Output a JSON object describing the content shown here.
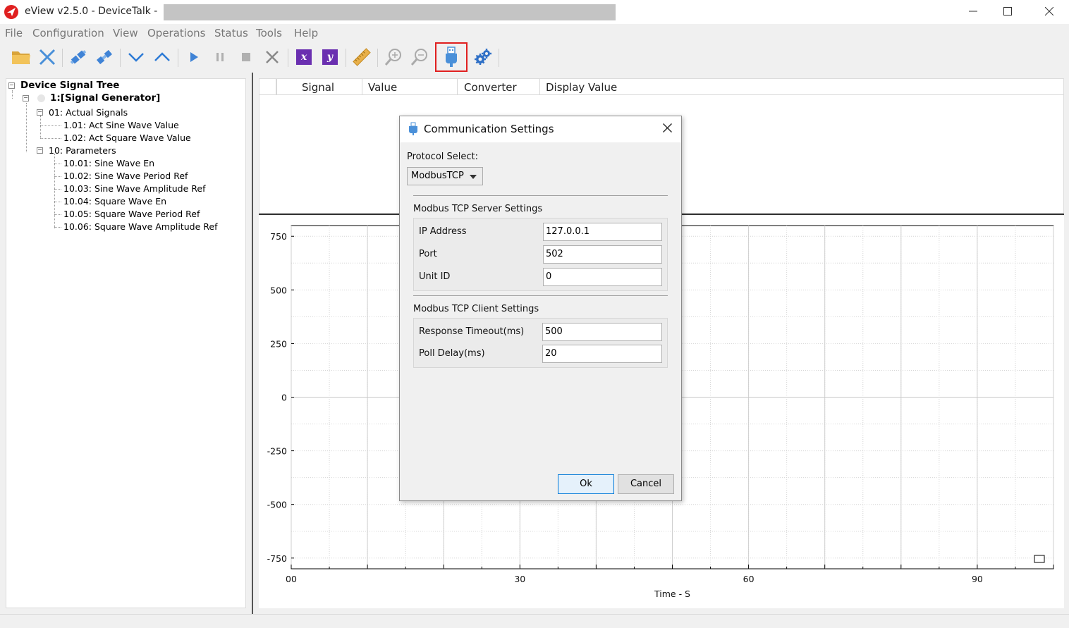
{
  "window": {
    "title": "eView v2.5.0 - DeviceTalk  -"
  },
  "menu": [
    "File",
    "Configuration",
    "View",
    "Operations",
    "Status",
    "Tools",
    "Help"
  ],
  "toolbar": {
    "icons": [
      "open-folder-icon",
      "close-x-icon",
      "connect-icon",
      "disconnect-icon",
      "chevron-down-icon",
      "chevron-up-icon",
      "play-icon",
      "pause-icon",
      "stop-icon",
      "cancel-icon",
      "x-axis-icon",
      "y-axis-icon",
      "ruler-icon",
      "zoom-in-icon",
      "zoom-out-icon",
      "usb-plug-icon",
      "gears-icon"
    ],
    "x_label": "x",
    "y_label": "y"
  },
  "tree": {
    "root": "Device Signal Tree",
    "device": "1:[Signal Generator]",
    "group1": "01: Actual Signals",
    "group1_items": [
      "1.01: Act Sine Wave Value",
      "1.02: Act Square Wave Value"
    ],
    "group2": "10: Parameters",
    "group2_items": [
      "10.01: Sine Wave En",
      "10.02: Sine Wave Period Ref",
      "10.03: Sine Wave Amplitude Ref",
      "10.04: Square Wave En",
      "10.05: Square Wave Period Ref",
      "10.06: Square Wave Amplitude Ref"
    ]
  },
  "signal_table": {
    "columns": [
      "Signal",
      "Value",
      "Converter",
      "Display Value"
    ]
  },
  "chart_data": {
    "type": "line",
    "series": [],
    "y_ticks": [
      "750",
      "500",
      "250",
      "0",
      "-250",
      "-500",
      "-750"
    ],
    "x_ticks": [
      "00",
      "30",
      "60",
      "90"
    ],
    "xlabel": "Time - S",
    "ylim": [
      -800,
      800
    ],
    "xlim": [
      0,
      100
    ],
    "grid": true
  },
  "dialog": {
    "title": "Communication Settings",
    "protocol_label": "Protocol Select:",
    "protocol_value": "ModbusTCP",
    "server_group": "Modbus TCP Server Settings",
    "ip_label": "IP Address",
    "ip_value": "127.0.0.1",
    "port_label": "Port",
    "port_value": "502",
    "unit_label": "Unit ID",
    "unit_value": "0",
    "client_group": "Modbus TCP Client Settings",
    "timeout_label": "Response Timeout(ms)",
    "timeout_value": "500",
    "poll_label": "Poll Delay(ms)",
    "poll_value": "20",
    "ok_label": "Ok",
    "cancel_label": "Cancel"
  },
  "colors": {
    "accent": "#0078d7",
    "highlight": "#e02020",
    "toolbar_blue": "#2e7bd6",
    "purple": "#6a2fb0"
  }
}
